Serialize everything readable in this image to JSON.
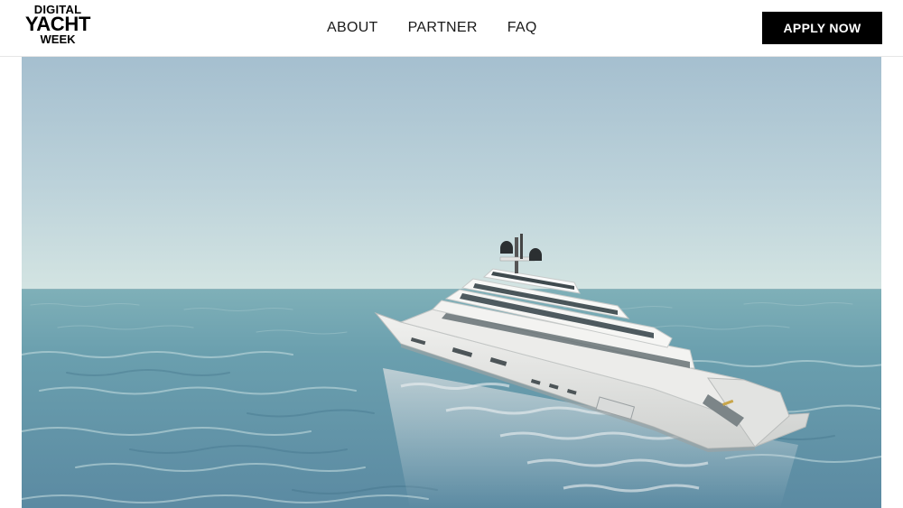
{
  "brand": {
    "line1": "DIGITAL",
    "line2": "YACHT",
    "line3": "WEEK"
  },
  "nav": {
    "items": [
      {
        "label": "ABOUT"
      },
      {
        "label": "PARTNER"
      },
      {
        "label": "FAQ"
      }
    ]
  },
  "cta": {
    "label": "APPLY NOW"
  },
  "hero": {
    "subject": "superyacht-on-open-sea",
    "colors": {
      "sky_top": "#a7c1d0",
      "sky_horizon": "#cde0e1",
      "sea": "#5d8ea2",
      "hull": "#e6e6e3"
    }
  }
}
